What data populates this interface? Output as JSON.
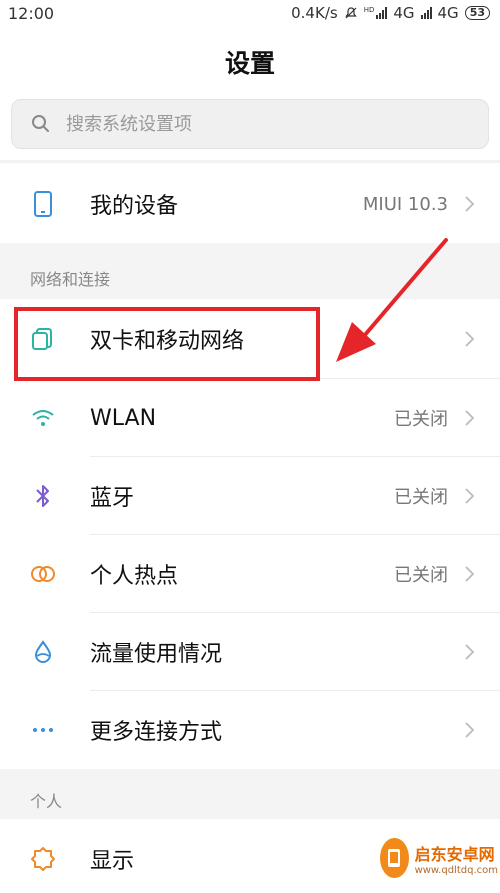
{
  "status_bar": {
    "time": "12:00",
    "speed": "0.4K/s",
    "hd_label": "HD",
    "net1": "4G",
    "net2": "4G",
    "battery": "53"
  },
  "header": {
    "title": "设置"
  },
  "search": {
    "placeholder": "搜索系统设置项"
  },
  "device": {
    "label": "我的设备",
    "value": "MIUI 10.3"
  },
  "section_network": {
    "title": "网络和连接",
    "items": [
      {
        "label": "双卡和移动网络",
        "value": "",
        "icon": "sim-card-icon"
      },
      {
        "label": "WLAN",
        "value": "已关闭",
        "icon": "wifi-icon"
      },
      {
        "label": "蓝牙",
        "value": "已关闭",
        "icon": "bluetooth-icon"
      },
      {
        "label": "个人热点",
        "value": "已关闭",
        "icon": "hotspot-icon"
      },
      {
        "label": "流量使用情况",
        "value": "",
        "icon": "data-usage-icon"
      },
      {
        "label": "更多连接方式",
        "value": "",
        "icon": "more-connections-icon"
      }
    ]
  },
  "section_personal": {
    "title": "个人",
    "items": [
      {
        "label": "显示",
        "icon": "display-icon"
      }
    ]
  },
  "watermark": {
    "name": "启东安卓网",
    "url": "www.qdltdq.com"
  },
  "colors": {
    "highlight": "#e4262a",
    "accent_teal": "#2bb3a5",
    "accent_purple": "#7a5bd1",
    "accent_orange": "#f08a2b"
  }
}
